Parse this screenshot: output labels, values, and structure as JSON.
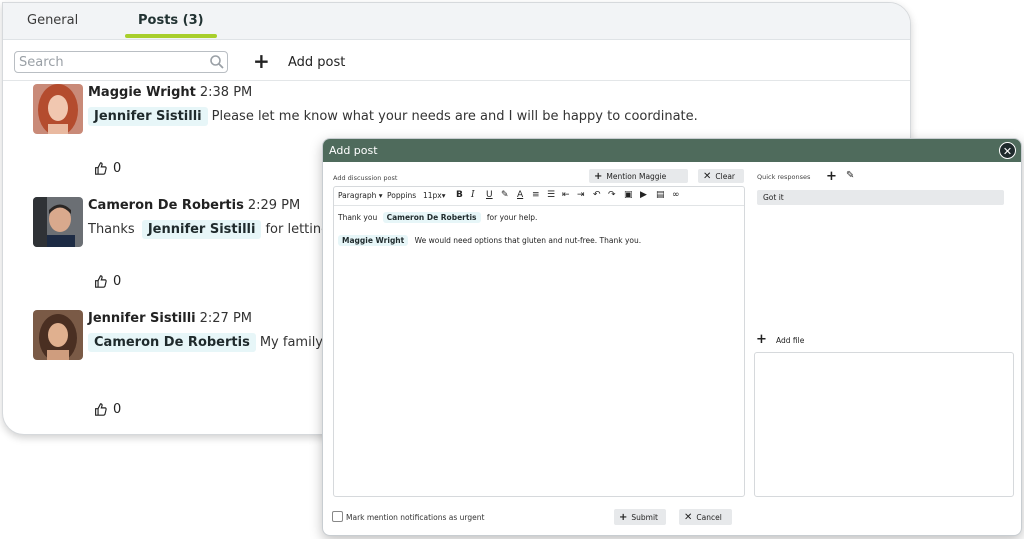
{
  "tabs": {
    "general": "General",
    "posts": "Posts (3)"
  },
  "toolbar": {
    "search_placeholder": "Search",
    "add_post": "Add post"
  },
  "posts": [
    {
      "author": "Maggie Wright",
      "time": "2:38 PM",
      "mention": "Jennifer Sistilli",
      "text": "Please let me know what your needs are and I will be happy to coordinate.",
      "likes": "0"
    },
    {
      "author": "Cameron De Robertis",
      "time": "2:29 PM",
      "prefix": "Thanks",
      "mention": "Jennifer Sistilli",
      "text": "for letting us k",
      "likes": "0"
    },
    {
      "author": "Jennifer Sistilli",
      "time": "2:27 PM",
      "mention": "Cameron De Robertis",
      "text": "My family has",
      "likes": "0"
    }
  ],
  "modal": {
    "title": "Add post",
    "close_icon": "close-icon",
    "add_discussion_label": "Add discussion post",
    "mention_button": "Mention Maggie",
    "clear_button": "Clear",
    "editor_toolbar": {
      "block": "Paragraph",
      "font": "Poppins",
      "size": "11px"
    },
    "content": {
      "line1_prefix": "Thank you",
      "line1_mention": "Cameron De Robertis",
      "line1_suffix": "for your help.",
      "line2_mention": "Maggie Wright",
      "line2_text": "We would need options that gluten and nut-free. Thank you."
    },
    "quick_responses_label": "Quick responses",
    "quick_responses": [
      "Got it"
    ],
    "add_file": "Add file",
    "urgent_label": "Mark mention notifications as urgent",
    "submit": "Submit",
    "cancel": "Cancel"
  },
  "colors": {
    "tab_underline": "#a8cf2c",
    "modal_header": "#4f6b5c",
    "mention_bg": "#e7f6f8"
  }
}
